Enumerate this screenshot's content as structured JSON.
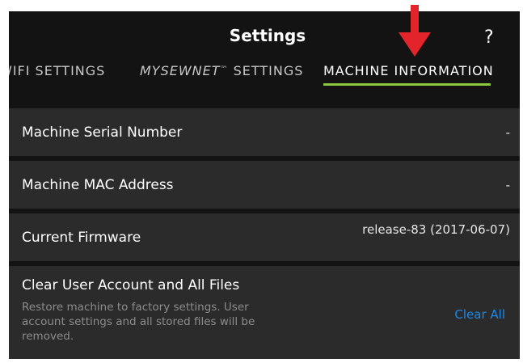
{
  "header": {
    "title": "Settings",
    "help_label": "?"
  },
  "tabs": {
    "wifi": "WIFI SETTINGS",
    "mysewnet_brand": "MYSEWNET",
    "mysewnet_tm": "™",
    "mysewnet_suffix": " SETTINGS",
    "machine_info": "MACHINE INFORMATION",
    "active": "machine_info"
  },
  "rows": {
    "serial_label": "Machine Serial Number",
    "serial_value": "-",
    "mac_label": "Machine MAC Address",
    "mac_value": "-",
    "firmware_label": "Current Firmware",
    "firmware_value": "release-83 (2017-06-07)",
    "clear_label": "Clear User Account and All Files",
    "clear_description": "Restore machine to factory settings. User account settings and all stored files will be removed.",
    "clear_button": "Clear All"
  },
  "colors": {
    "background": "#131313",
    "row_background": "#2b2b2b",
    "active_tab_underline": "#8dc63f",
    "link_blue": "#1e88e5",
    "annotation_arrow": "#e3242b"
  }
}
